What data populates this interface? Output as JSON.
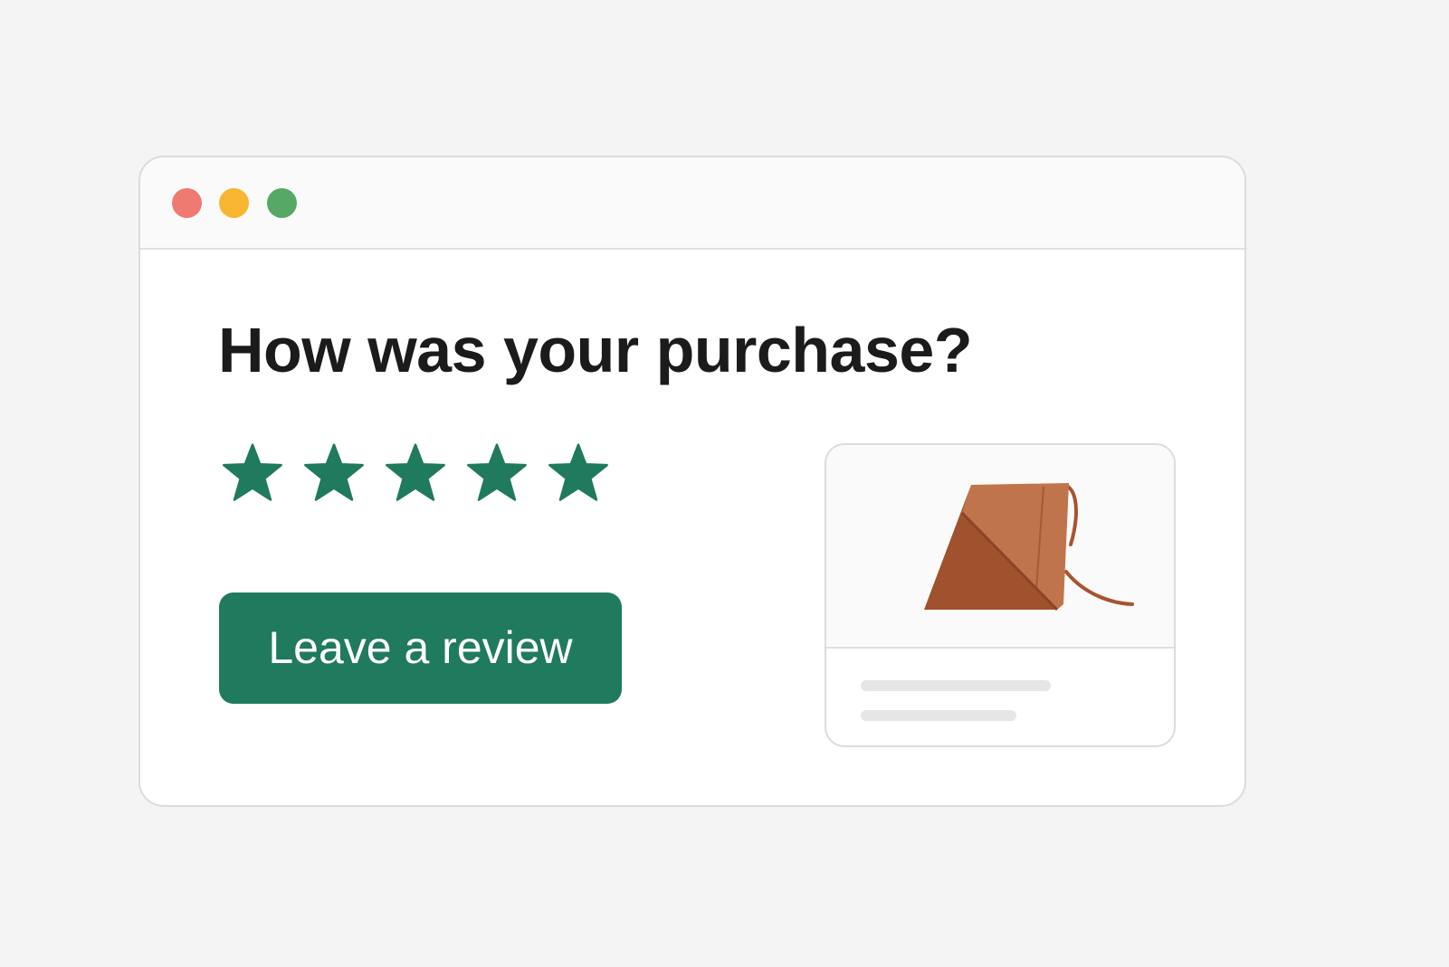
{
  "window": {
    "controls": [
      {
        "name": "close",
        "color": "#ef7a72"
      },
      {
        "name": "minimize",
        "color": "#f8b630"
      },
      {
        "name": "maximize",
        "color": "#55a866"
      }
    ]
  },
  "review": {
    "heading": "How was your purchase?",
    "rating": {
      "value": 5,
      "max": 5,
      "color": "#1f7a5e",
      "icon": "star-icon"
    },
    "button_label": "Leave a review",
    "button_color": "#1f7a5e"
  },
  "product": {
    "image_icon": "leather-bag-icon",
    "bag_colors": {
      "front": "#a0512e",
      "flap": "#bf744c",
      "strap": "#a8542f"
    }
  }
}
